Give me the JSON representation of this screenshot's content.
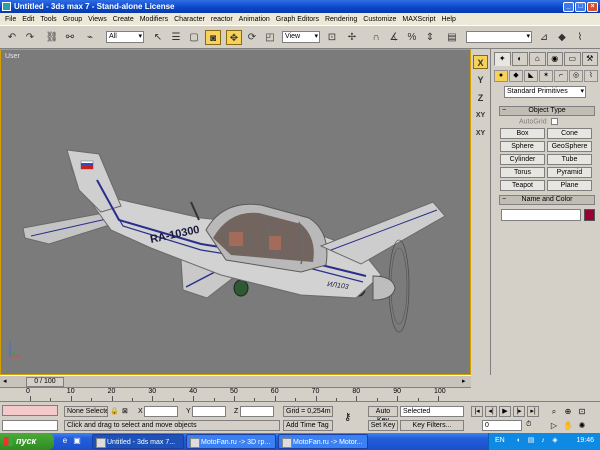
{
  "window": {
    "title": "Untitled   - 3ds max 7  - Stand-alone License",
    "buttons": [
      "_",
      "□",
      "×"
    ]
  },
  "menu": [
    "File",
    "Edit",
    "Tools",
    "Group",
    "Views",
    "Create",
    "Modifiers",
    "Character",
    "reactor",
    "Animation",
    "Graph Editors",
    "Rendering",
    "Customize",
    "MAXScript",
    "Help"
  ],
  "toolbar": {
    "selection_filter": "All",
    "ref_coord": "View",
    "named_selection": ""
  },
  "viewport": {
    "label": "User",
    "plane_registration": "RA-10300",
    "plane_nose_text": "ИЛ103",
    "bg_color": "#7b7b7b"
  },
  "nav_column": [
    "X",
    "Y",
    "Z",
    "XY",
    "XY"
  ],
  "command_panel": {
    "tabs": [
      "✦",
      "◐",
      "⌂",
      "◉",
      "▭",
      "⚒"
    ],
    "category_icons": [
      "●",
      "◆",
      "◣",
      "✶",
      "⌐",
      "◎",
      "⌇"
    ],
    "primitives_dropdown": "Standard Primitives",
    "object_type_title": "Object Type",
    "autogrid_label": "AutoGrid",
    "object_buttons": [
      "Box",
      "Cone",
      "Sphere",
      "GeoSphere",
      "Cylinder",
      "Tube",
      "Torus",
      "Pyramid",
      "Teapot",
      "Plane"
    ],
    "name_color_title": "Name and Color",
    "object_color": "#990033"
  },
  "timeline": {
    "slider_label": "0 / 100",
    "ticks": [
      "0",
      "10",
      "20",
      "30",
      "40",
      "50",
      "60",
      "70",
      "80",
      "90",
      "100"
    ]
  },
  "status": {
    "selection": "None Selecte",
    "x_label": "X",
    "y_label": "Y",
    "z_label": "Z",
    "grid": "Grid = 0,254m",
    "prompt": "Click and drag to select and move objects",
    "add_time_tag": "Add Time Tag",
    "auto_key": "Auto Key",
    "auto_key_select": "Selected",
    "set_key": "Set Key",
    "key_filters": "Key Filters...",
    "frame": "0"
  },
  "taskbar": {
    "start": "пуск",
    "tasks": [
      "Untitled  - 3ds max 7...",
      "MotoFan.ru -> 3D гр...",
      "MotoFan.ru -> Motor..."
    ],
    "lang": "EN",
    "clock": "19:46"
  }
}
